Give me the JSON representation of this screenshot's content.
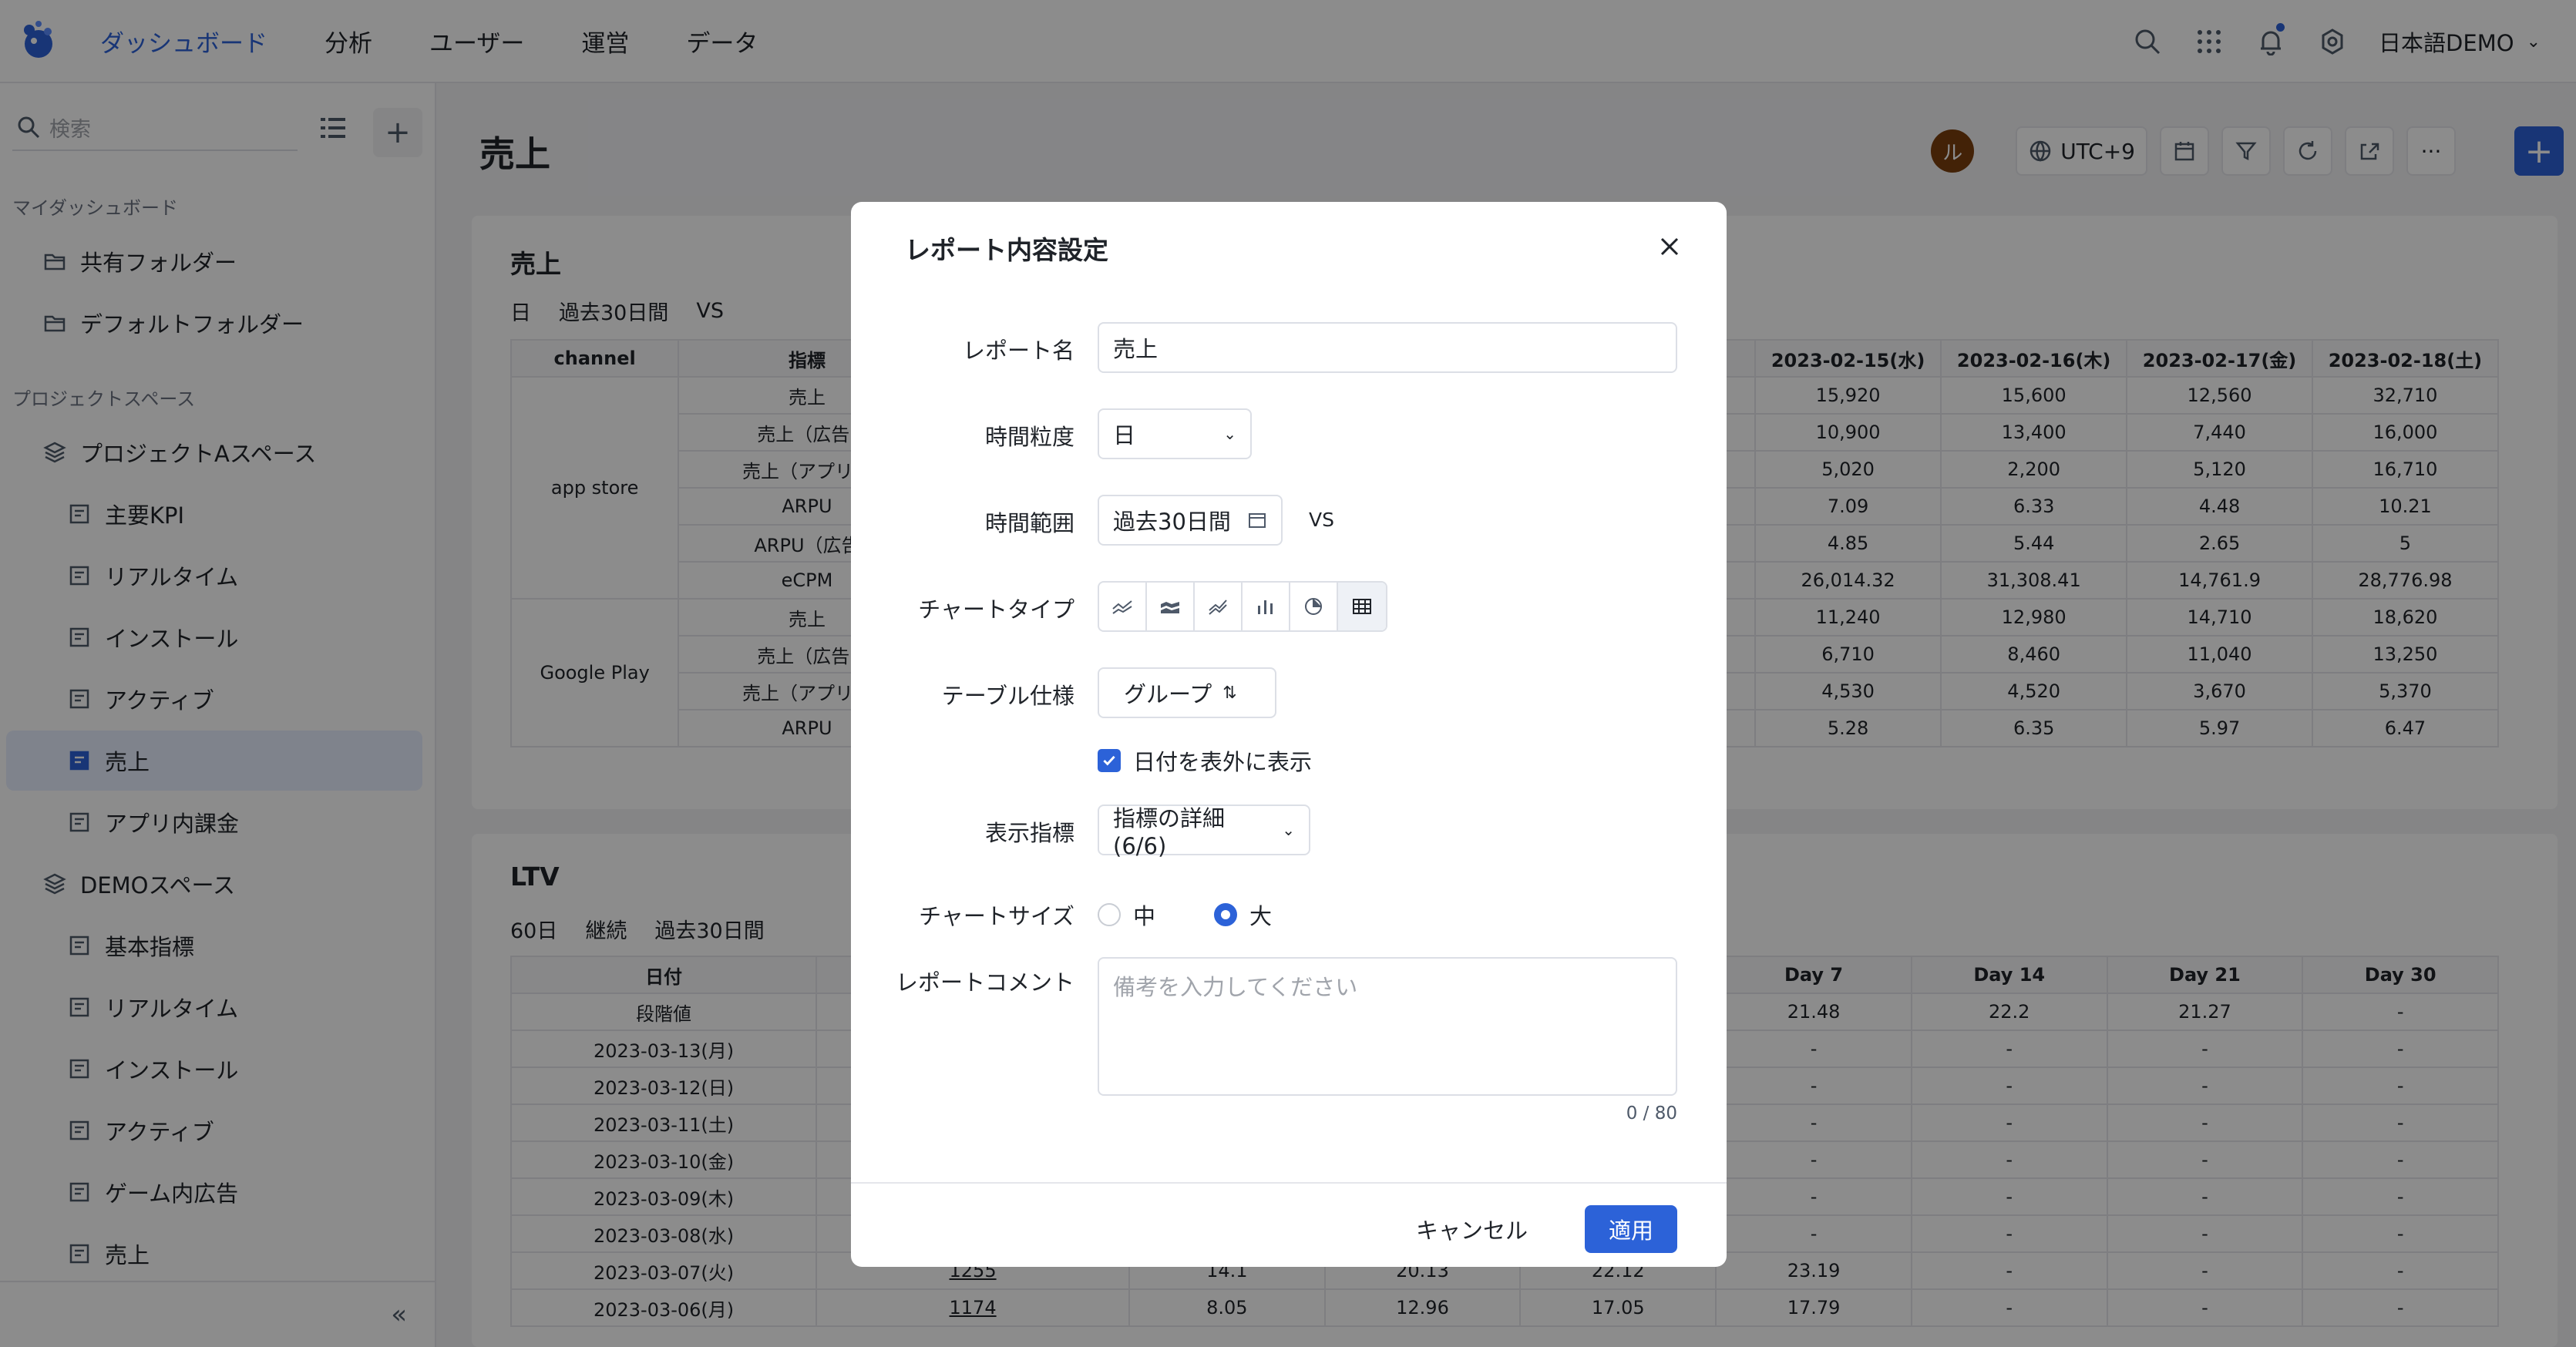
{
  "nav": {
    "items": [
      "ダッシュボード",
      "分析",
      "ユーザー",
      "運営",
      "データ"
    ],
    "user_label": "日本語DEMO"
  },
  "sidebar": {
    "search_placeholder": "検索",
    "section_my": "マイダッシュボード",
    "section_project": "プロジェクトスペース",
    "items": [
      {
        "label": "共有フォルダー",
        "icon": "folder-icon"
      },
      {
        "label": "デフォルトフォルダー",
        "icon": "folder-icon"
      },
      {
        "label": "プロジェクトAスペース",
        "icon": "layers-icon"
      },
      {
        "label": "主要KPI",
        "icon": "report-icon"
      },
      {
        "label": "リアルタイム",
        "icon": "report-icon"
      },
      {
        "label": "インストール",
        "icon": "report-icon"
      },
      {
        "label": "アクティブ",
        "icon": "report-icon"
      },
      {
        "label": "売上",
        "icon": "report-icon"
      },
      {
        "label": "アプリ内課金",
        "icon": "report-icon"
      },
      {
        "label": "DEMOスペース",
        "icon": "layers-icon"
      },
      {
        "label": "基本指標",
        "icon": "report-icon"
      },
      {
        "label": "リアルタイム",
        "icon": "report-icon"
      },
      {
        "label": "インストール",
        "icon": "report-icon"
      },
      {
        "label": "アクティブ",
        "icon": "report-icon"
      },
      {
        "label": "ゲーム内広告",
        "icon": "report-icon"
      },
      {
        "label": "売上",
        "icon": "report-icon"
      }
    ],
    "collapse_glyph": "«"
  },
  "main": {
    "title": "売上",
    "avatar_initial": "ル",
    "timezone": "UTC+9",
    "more_glyph": "···",
    "add_glyph": "+"
  },
  "sales_card": {
    "title": "売上",
    "meta": [
      "日",
      "過去30日間",
      "VS"
    ],
    "col_channel": "channel",
    "col_metric": "指標",
    "date_headers": [
      "2023-02-15(水)",
      "2023-02-16(木)",
      "2023-02-17(金)",
      "2023-02-18(土)"
    ],
    "channels": [
      "app store",
      "Google Play"
    ],
    "metrics": [
      "売上",
      "売上（広告)",
      "売上（アプリ内",
      "ARPU",
      "ARPU（広告",
      "eCPM",
      "売上",
      "売上（広告)",
      "売上（アプリ内",
      "ARPU"
    ],
    "values": [
      [
        "15,920",
        "15,600",
        "12,560",
        "32,710"
      ],
      [
        "10,900",
        "13,400",
        "7,440",
        "16,000"
      ],
      [
        "5,020",
        "2,200",
        "5,120",
        "16,710"
      ],
      [
        "7.09",
        "6.33",
        "4.48",
        "10.21"
      ],
      [
        "4.85",
        "5.44",
        "2.65",
        "5"
      ],
      [
        "26,014.32",
        "31,308.41",
        "14,761.9",
        "28,776.98"
      ],
      [
        "11,240",
        "12,980",
        "14,710",
        "18,620"
      ],
      [
        "6,710",
        "8,460",
        "11,040",
        "13,250"
      ],
      [
        "4,530",
        "4,520",
        "3,670",
        "5,370"
      ],
      [
        "5.28",
        "6.35",
        "5.97",
        "6.47"
      ]
    ]
  },
  "ltv_card": {
    "title": "LTV",
    "meta": [
      "60日",
      "継続",
      "過去30日間"
    ],
    "col_date": "日付",
    "day_headers": [
      "Day 7",
      "Day 14",
      "Day 21",
      "Day 30"
    ],
    "rows": [
      {
        "date": "段階値",
        "users": "",
        "c1": "",
        "c2": "",
        "c3": "",
        "d7": "21.48",
        "d14": "22.2",
        "d21": "21.27",
        "d30": "-"
      },
      {
        "date": "2023-03-13(月)",
        "users": "",
        "c1": "",
        "c2": "",
        "c3": "",
        "d7": "-",
        "d14": "-",
        "d21": "-",
        "d30": "-"
      },
      {
        "date": "2023-03-12(日)",
        "users": "",
        "c1": "",
        "c2": "",
        "c3": "",
        "d7": "-",
        "d14": "-",
        "d21": "-",
        "d30": "-"
      },
      {
        "date": "2023-03-11(土)",
        "users": "",
        "c1": "",
        "c2": "",
        "c3": "",
        "d7": "-",
        "d14": "-",
        "d21": "-",
        "d30": "-"
      },
      {
        "date": "2023-03-10(金)",
        "users": "",
        "c1": "",
        "c2": "",
        "c3": "",
        "d7": "-",
        "d14": "-",
        "d21": "-",
        "d30": "-"
      },
      {
        "date": "2023-03-09(木)",
        "users": "",
        "c1": "",
        "c2": "",
        "c3": "",
        "d7": "-",
        "d14": "-",
        "d21": "-",
        "d30": "-"
      },
      {
        "date": "2023-03-08(水)",
        "users": "",
        "c1": "",
        "c2": "",
        "c3": "",
        "d7": "-",
        "d14": "-",
        "d21": "-",
        "d30": "-"
      },
      {
        "date": "2023-03-07(火)",
        "users": "1255",
        "c1": "14.1",
        "c2": "20.13",
        "c3": "22.12",
        "d7": "23.19",
        "d14": "-",
        "d21": "-",
        "d30": "-"
      },
      {
        "date": "2023-03-06(月)",
        "users": "1174",
        "c1": "8.05",
        "c2": "12.96",
        "c3": "17.05",
        "d7": "17.79",
        "d14": "-",
        "d21": "-",
        "d30": "-"
      }
    ]
  },
  "modal": {
    "title": "レポート内容設定",
    "report_name_label": "レポート名",
    "report_name_value": "売上",
    "granularity_label": "時間粒度",
    "granularity_value": "日",
    "range_label": "時間範囲",
    "range_value": "過去30日間",
    "vs_label": "VS",
    "chart_type_label": "チャートタイプ",
    "chart_types": [
      "line-chart-icon",
      "area-chart-icon",
      "trend-chart-icon",
      "bar-chart-icon",
      "pie-chart-icon",
      "table-icon"
    ],
    "chart_type_selected": "table-icon",
    "table_spec_label": "テーブル仕様",
    "table_spec_value": "グループ",
    "outside_date_label": "日付を表外に表示",
    "outside_date_checked": true,
    "metrics_label": "表示指標",
    "metrics_value": "指標の詳細 (6/6)",
    "chart_size_label": "チャートサイズ",
    "size_medium": "中",
    "size_large": "大",
    "size_selected": "大",
    "comment_label": "レポートコメント",
    "comment_placeholder": "備考を入力してください",
    "comment_counter": "0 / 80",
    "cancel_label": "キャンセル",
    "apply_label": "適用"
  },
  "colors": {
    "primary": "#2c62d8",
    "overlay": "rgba(0,0,0,0.45)",
    "avatar": "#7a3e0e"
  }
}
